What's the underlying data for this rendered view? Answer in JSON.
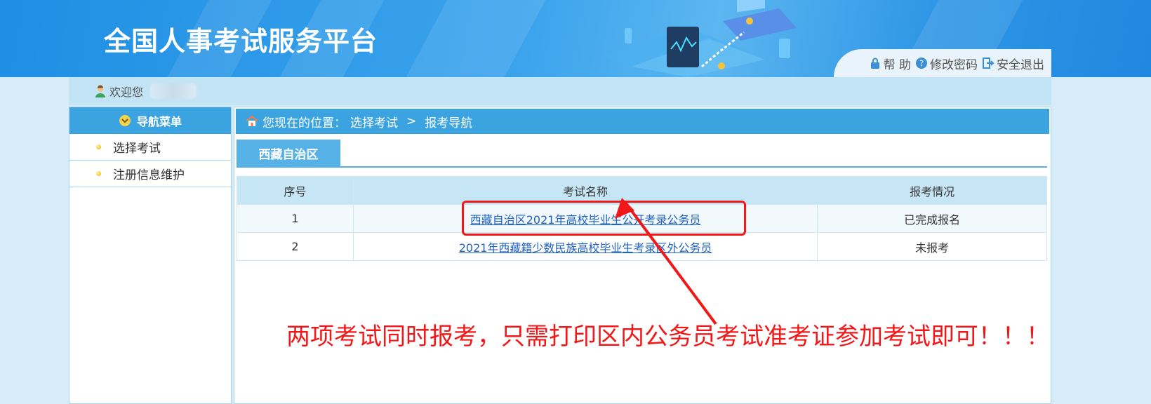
{
  "header": {
    "title": "全国人事考试服务平台",
    "links": [
      {
        "icon": "lock-icon",
        "label": "帮 助"
      },
      {
        "icon": "question-icon",
        "label": "修改密码"
      },
      {
        "icon": "exit-icon",
        "label": "安全退出"
      }
    ]
  },
  "welcome": {
    "label": "欢迎您"
  },
  "sidebar": {
    "title": "导航菜单",
    "items": [
      {
        "label": "选择考试"
      },
      {
        "label": "注册信息维护"
      }
    ]
  },
  "breadcrumb": {
    "prefix": "您现在的位置：",
    "path": [
      "选择考试",
      ">",
      "报考导航"
    ]
  },
  "tab": {
    "label": "西藏自治区"
  },
  "table": {
    "headers": [
      "序号",
      "考试名称",
      "报考情况"
    ],
    "rows": [
      {
        "no": "1",
        "name": "西藏自治区2021年高校毕业生公开考录公务员",
        "status": "已完成报名"
      },
      {
        "no": "2",
        "name": "2021年西藏籍少数民族高校毕业生考录区外公务员",
        "status": "未报考"
      }
    ]
  },
  "annotation": {
    "text": "两项考试同时报考，只需打印区内公务员考试准考证参加考试即可！！！",
    "color": "#f01818"
  },
  "colors": {
    "accent": "#3ba3df",
    "header": "#2f97e6",
    "link": "#1f62c4"
  }
}
